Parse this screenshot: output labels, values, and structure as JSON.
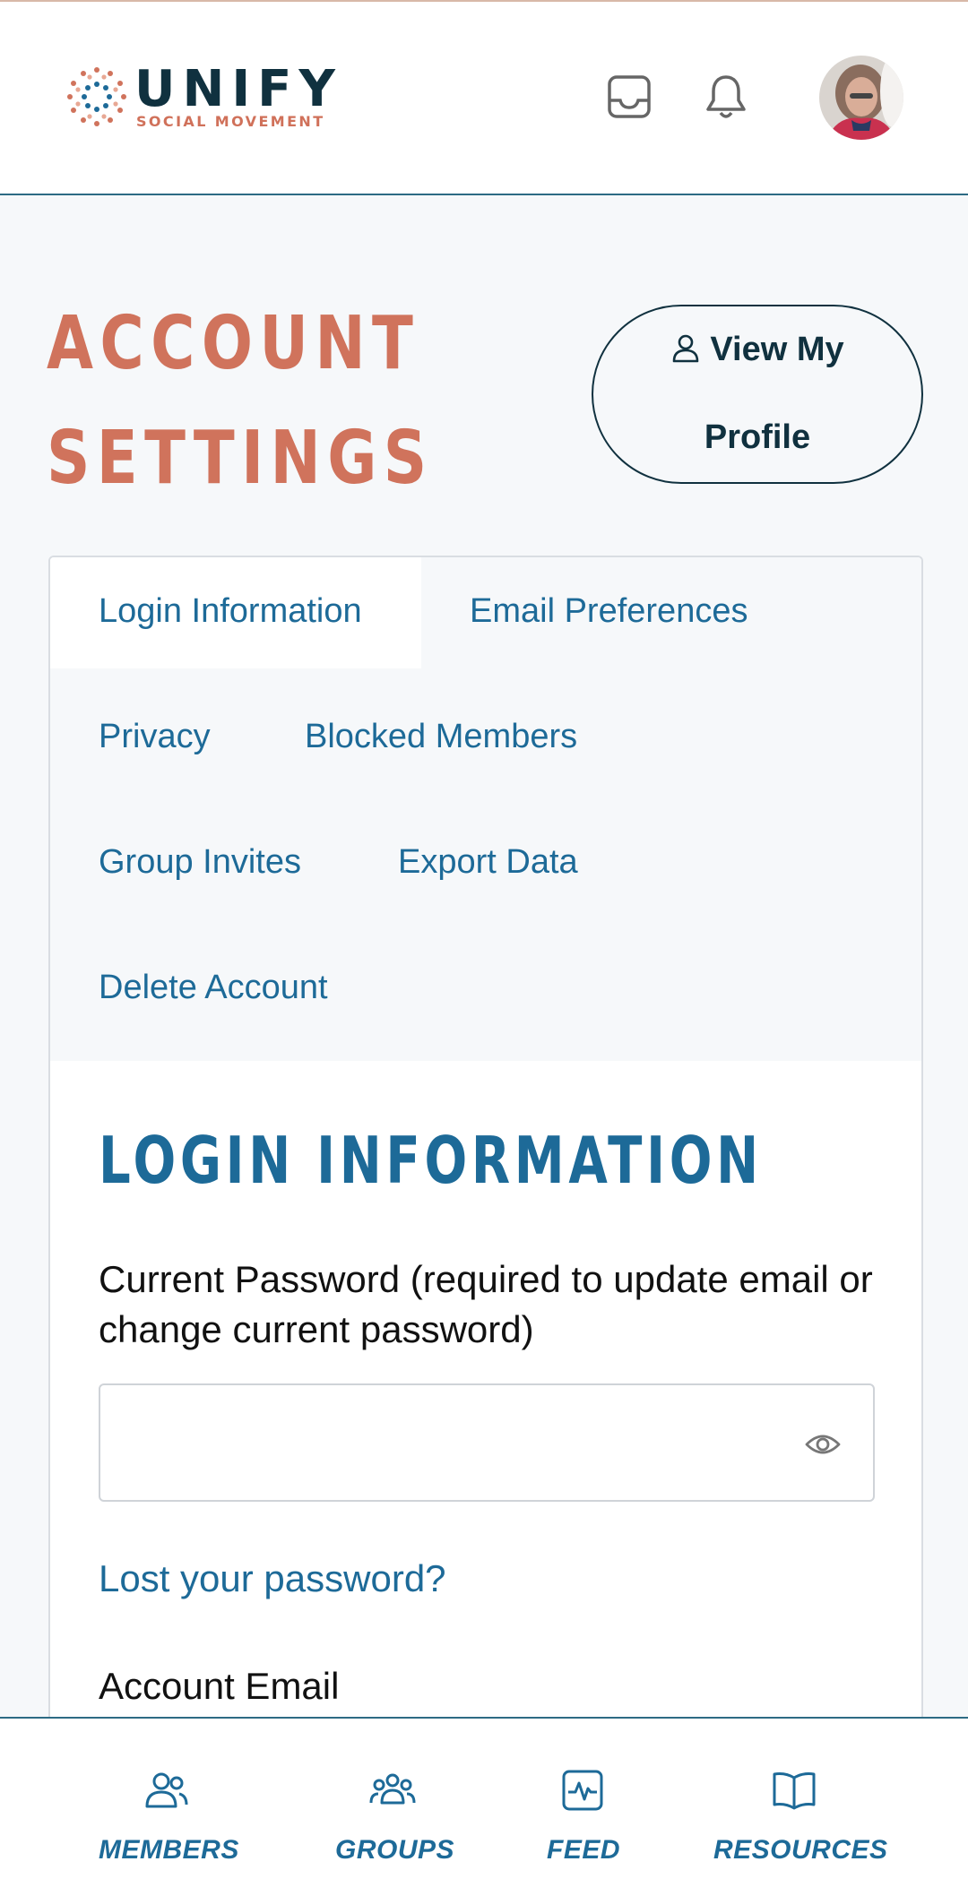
{
  "header": {
    "logo_word": "UNIFY",
    "logo_tagline": "SOCIAL MOVEMENT",
    "icons": [
      "inbox-icon",
      "bell-icon"
    ],
    "avatar": "user-avatar"
  },
  "page": {
    "title_line1": "ACCOUNT",
    "title_line2": "SETTINGS",
    "view_profile_line1": "View My",
    "view_profile_line2": "Profile"
  },
  "tabs": [
    {
      "label": "Login Information",
      "active": true
    },
    {
      "label": "Email Preferences",
      "active": false
    },
    {
      "label": "Privacy",
      "active": false
    },
    {
      "label": "Blocked Members",
      "active": false
    },
    {
      "label": "Group Invites",
      "active": false
    },
    {
      "label": "Export Data",
      "active": false
    },
    {
      "label": "Delete Account",
      "active": false
    }
  ],
  "login": {
    "section_title": "LOGIN INFORMATION",
    "current_password_label": "Current Password (required to update email or change current password)",
    "current_password_value": "",
    "lost_password_link": "Lost your password?",
    "account_email_label": "Account Email"
  },
  "bottom_nav": [
    {
      "label": "MEMBERS",
      "icon": "members-icon"
    },
    {
      "label": "GROUPS",
      "icon": "groups-icon"
    },
    {
      "label": "FEED",
      "icon": "feed-icon"
    },
    {
      "label": "RESOURCES",
      "icon": "book-icon"
    }
  ],
  "colors": {
    "brand_dark": "#10313f",
    "brand_orange": "#d0735c",
    "link_blue": "#1d6a98",
    "background": "#f6f8fa"
  }
}
